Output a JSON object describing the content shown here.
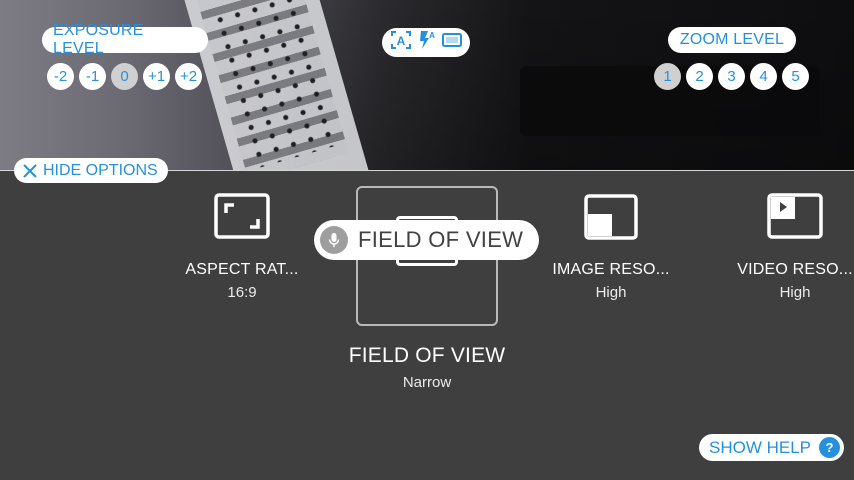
{
  "exposure": {
    "label": "EXPOSURE LEVEL",
    "options": [
      "-2",
      "-1",
      "0",
      "+1",
      "+2"
    ],
    "selected": "0"
  },
  "zoom": {
    "label": "ZOOM LEVEL",
    "options": [
      "1",
      "2",
      "3",
      "4",
      "5"
    ],
    "selected": "1"
  },
  "status_icons": [
    "auto-focus-icon",
    "flash-auto-icon",
    "aspect-frame-icon"
  ],
  "hide_options_label": "HIDE OPTIONS",
  "settings": [
    {
      "title": "ASPECT RAT...",
      "value": "16:9",
      "icon": "aspect-ratio-icon"
    },
    {
      "title": "FIELD OF VIEW",
      "value": "Narrow",
      "icon": "field-of-view-icon",
      "focused": true
    },
    {
      "title": "IMAGE RESO...",
      "value": "High",
      "icon": "image-resolution-icon"
    },
    {
      "title": "VIDEO RESO...",
      "value": "High",
      "icon": "video-resolution-icon"
    }
  ],
  "voice_tooltip": {
    "text": "FIELD OF VIEW",
    "icon": "microphone-icon"
  },
  "show_help": {
    "label": "SHOW HELP",
    "icon_text": "?"
  },
  "colors": {
    "accent": "#2591de",
    "panel": "#3f3f3f",
    "pill": "#ffffff",
    "selected_circle": "#d0d0d0"
  }
}
